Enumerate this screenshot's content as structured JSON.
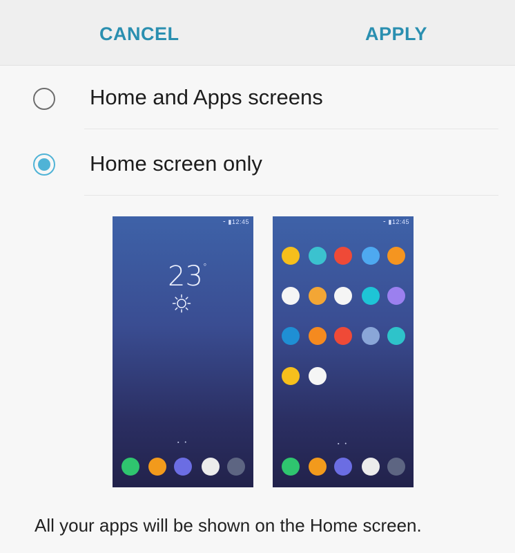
{
  "top_bar": {
    "cancel_label": "CANCEL",
    "apply_label": "APPLY"
  },
  "options": [
    {
      "label": "Home and Apps screens",
      "selected": false
    },
    {
      "label": "Home screen only",
      "selected": true
    }
  ],
  "preview_left": {
    "status_text": "⁃ ▮12:45",
    "temperature": "23",
    "degree": "°",
    "weather_icon": "sun-icon",
    "page_indicator": "▪ •",
    "dock_colors": [
      "#2fc56f",
      "#f29a1c",
      "#6b6de3",
      "#ececec",
      "#5d6582"
    ]
  },
  "preview_right": {
    "status_text": "⁃ ▮12:45",
    "page_indicator": "▪ •",
    "grid_colors": [
      [
        "#f6bf1c",
        "#3bc2cf",
        "#ef4a37",
        "#4ea9f0",
        "#f59520"
      ],
      [
        "#f5f5f5",
        "#f3a635",
        "#f5f5f5",
        "#1ec5d6",
        "#9b80ef"
      ],
      [
        "#1f8fd4",
        "#f58a1f",
        "#ef4a37",
        "#8aa6d8",
        "#2ec3ca"
      ],
      [
        "#f6bf1c",
        "#f5f5f5"
      ]
    ],
    "dock_colors": [
      "#2fc56f",
      "#f29a1c",
      "#6b6de3",
      "#ececec",
      "#5d6582"
    ]
  },
  "description": "All your apps will be shown on the Home screen.",
  "colors": {
    "accent": "#2a8fb0",
    "radio_selected": "#4fb3d6"
  }
}
